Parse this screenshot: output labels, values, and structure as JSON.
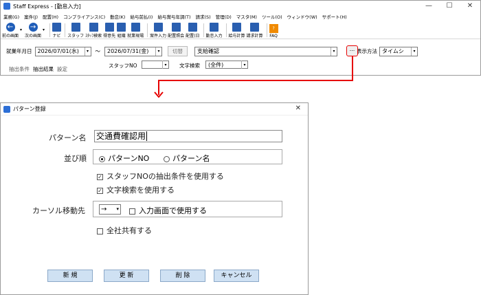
{
  "main_window": {
    "title": "Staff Express - [勤怠入力]",
    "controls": [
      "—",
      "☐",
      "✕"
    ],
    "menu": [
      "業務(G)",
      "案件(J)",
      "配置(H)",
      "コンプライアンス(C)",
      "勤怠(K)",
      "給与前払(I)",
      "給与賞与年調(T)",
      "請求(S)",
      "管理(D)",
      "マスタ(M)",
      "ツール(O)",
      "ウィンドウ(W)",
      "サポート(H)"
    ],
    "toolbar": [
      "前の画面",
      "次の画面",
      "ナビ",
      "スタッフ",
      "ｽﾀｯﾌ検索",
      "得意先",
      "組織",
      "就業現場",
      "案件入力",
      "配置照会",
      "配置(日",
      "勤怠入力",
      "給与計算",
      "請求計算",
      "FAQ"
    ],
    "period_label": "就業年月日",
    "date_from": "2026/07/01(水)",
    "date_sep": "〜",
    "date_to": "2026/07/31(金)",
    "switch_label": "切替",
    "pattern_value": "支給確認",
    "ellipsis": "...",
    "display_label": "表示方法",
    "display_value": "タイムシ",
    "staff_no_label": "スタッフNO",
    "text_search_label": "文字検索",
    "text_search_value": "(全件)",
    "tabs": [
      "抽出条件",
      "抽出結果",
      "設定"
    ]
  },
  "dialog": {
    "title": "パターン登録",
    "close": "✕",
    "pattern_name_label": "パターン名",
    "pattern_name_value": "交通費確認用",
    "sort_label": "並び順",
    "sort_opt1": "パターンNO",
    "sort_opt2": "パターン名",
    "use_staff_no": "スタッフNOの抽出条件を使用する",
    "use_text_search": "文字検索を使用する",
    "cursor_label": "カーソル移動先",
    "cursor_value": "→",
    "use_in_input": "入力画面で使用する",
    "share_all": "全社共有する",
    "btn_new": "新 規",
    "btn_update": "更 新",
    "btn_delete": "削 除",
    "btn_cancel": "キャンセル"
  },
  "colors": {
    "accent": "#e60000",
    "button_bg": "#cfe1f3",
    "icon_blue": "#1f5db8"
  }
}
